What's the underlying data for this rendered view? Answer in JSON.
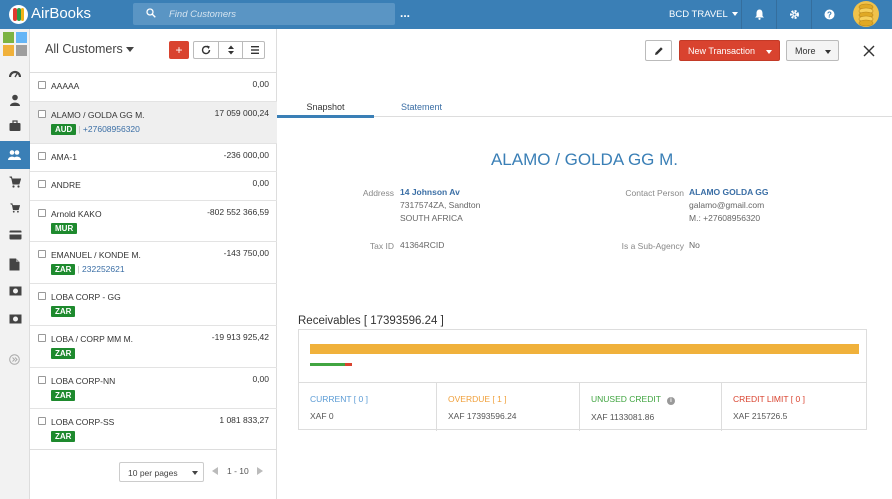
{
  "app": {
    "title": "AirBooks"
  },
  "search": {
    "placeholder": "Find Customers",
    "more": "..."
  },
  "company": {
    "name": "BCD TRAVEL"
  },
  "colors": {
    "brand": "#3a7fb6",
    "danger": "#d9432f",
    "success": "#1e8a2e",
    "warning": "#f0b13b"
  },
  "rail": {
    "items": [
      {
        "icon": "apps-grid-icon"
      },
      {
        "icon": "dashboard-icon"
      },
      {
        "icon": "user-icon"
      },
      {
        "icon": "briefcase-icon"
      },
      {
        "icon": "customers-icon",
        "active": true
      },
      {
        "icon": "cart-icon"
      },
      {
        "icon": "small-cart-icon"
      },
      {
        "icon": "credit-card-icon"
      },
      {
        "icon": "document-icon"
      },
      {
        "icon": "money-icon"
      },
      {
        "icon": "money-icon"
      },
      {
        "icon": "expand-icon"
      }
    ]
  },
  "list": {
    "title": "All Customers",
    "add_label": "+",
    "rows": [
      {
        "name": "AAAAA",
        "amount": "0,00"
      },
      {
        "name": "ALAMO / GOLDA GG M.",
        "amount": "17 059 000,24",
        "currency": "AUD",
        "phone": "+27608956320"
      },
      {
        "name": "AMA-1",
        "amount": "-236 000,00"
      },
      {
        "name": "ANDRE",
        "amount": "0,00"
      },
      {
        "name": "Arnold KAKO",
        "amount": "-802 552 366,59",
        "currency": "MUR"
      },
      {
        "name": "EMANUEL / KONDE M.",
        "amount": "-143 750,00",
        "currency": "ZAR",
        "phone": "232252621"
      },
      {
        "name": "LOBA CORP - GG",
        "amount": "",
        "currency": "ZAR"
      },
      {
        "name": "LOBA / CORP MM M.",
        "amount": "-19 913 925,42",
        "currency": "ZAR"
      },
      {
        "name": "LOBA CORP-NN",
        "amount": "0,00",
        "currency": "ZAR"
      },
      {
        "name": "LOBA CORP-SS",
        "amount": "1 081 833,27",
        "currency": "ZAR"
      }
    ],
    "pager": {
      "per_page": "10 per pages",
      "range": "1 - 10"
    }
  },
  "detail": {
    "new_transaction": "New Transaction",
    "more": "More",
    "tabs": {
      "snapshot": "Snapshot",
      "statement": "Statement"
    },
    "customer_name": "ALAMO / GOLDA GG M.",
    "address": {
      "label": "Address",
      "line1": "14 Johnson Av",
      "line2": "7317574ZA, Sandton",
      "line3": "SOUTH AFRICA"
    },
    "tax": {
      "label": "Tax ID",
      "value": "41364RCID"
    },
    "contact": {
      "label": "Contact Person",
      "name": "ALAMO GOLDA GG",
      "email": "galamo@gmail.com",
      "mobile": "M.: +27608956320"
    },
    "sub_agency": {
      "label": "Is a Sub-Agency",
      "value": "No"
    },
    "receivables": {
      "title": "Receivables [ 17393596.24 ]",
      "current": {
        "label": "CURRENT [ 0 ]",
        "value": "XAF 0",
        "color": "#5b9bd5"
      },
      "overdue": {
        "label": "OVERDUE [ 1 ]",
        "value": "XAF 17393596.24",
        "color": "#f0a03b"
      },
      "unused": {
        "label": "UNUSED CREDIT",
        "value": "XAF 1133081.86",
        "color": "#41a541"
      },
      "credit_limit": {
        "label": "CREDIT LIMIT [ 0 ]",
        "value": "XAF 215726.5",
        "color": "#d9432f"
      }
    }
  }
}
